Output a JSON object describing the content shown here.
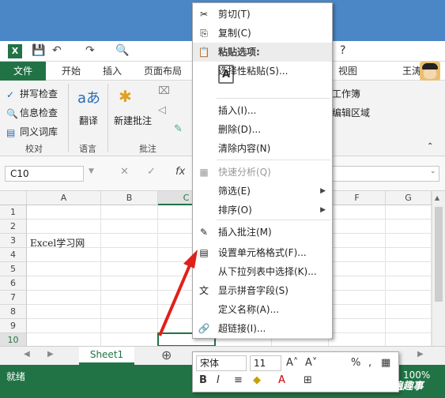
{
  "quick_access": {
    "undo": "↶",
    "redo": "↷",
    "preview": "🔍"
  },
  "window": {
    "help": "?",
    "restore": "❐",
    "close": "✕"
  },
  "tabs": [
    "文件",
    "开始",
    "插入",
    "页面布局",
    "视图"
  ],
  "user": "王涛",
  "ribbon": {
    "proof": [
      "拼写检查",
      "信息检查",
      "同义词库"
    ],
    "proof_group": "校对",
    "translate": "翻译",
    "lang_group": "语言",
    "new_comment": "新建批注",
    "comment_group": "批注",
    "right_items": [
      "工作簿",
      "编辑区域"
    ]
  },
  "namebox": "C10",
  "fx": "fx",
  "columns": [
    "A",
    "B",
    "C",
    "D",
    "E",
    "F",
    "G"
  ],
  "rows": [
    "1",
    "2",
    "3",
    "4",
    "5",
    "6",
    "7",
    "8",
    "9",
    "10"
  ],
  "cell_a3": "Excel学习网",
  "sheet": "Sheet1",
  "status": "就绪",
  "zoom": "100%",
  "watermark": "头条 @传遍趣事",
  "context_menu": [
    {
      "label": "剪切(T)",
      "icon": "✂"
    },
    {
      "label": "复制(C)",
      "icon": "⎘"
    },
    {
      "label": "粘贴选项:",
      "icon": "📋"
    },
    {
      "label": "选择性粘贴(S)...",
      "icon": ""
    },
    {
      "label": "插入(I)...",
      "icon": ""
    },
    {
      "label": "删除(D)...",
      "icon": ""
    },
    {
      "label": "清除内容(N)",
      "icon": ""
    },
    {
      "label": "快速分析(Q)",
      "icon": "▦"
    },
    {
      "label": "筛选(E)",
      "icon": ""
    },
    {
      "label": "排序(O)",
      "icon": ""
    },
    {
      "label": "插入批注(M)",
      "icon": "✎"
    },
    {
      "label": "设置单元格格式(F)...",
      "icon": "▤"
    },
    {
      "label": "从下拉列表中选择(K)...",
      "icon": ""
    },
    {
      "label": "显示拼音字段(S)",
      "icon": "文"
    },
    {
      "label": "定义名称(A)...",
      "icon": ""
    },
    {
      "label": "超链接(I)...",
      "icon": "🔗"
    }
  ],
  "mini": {
    "font": "宋体",
    "size": "11"
  }
}
